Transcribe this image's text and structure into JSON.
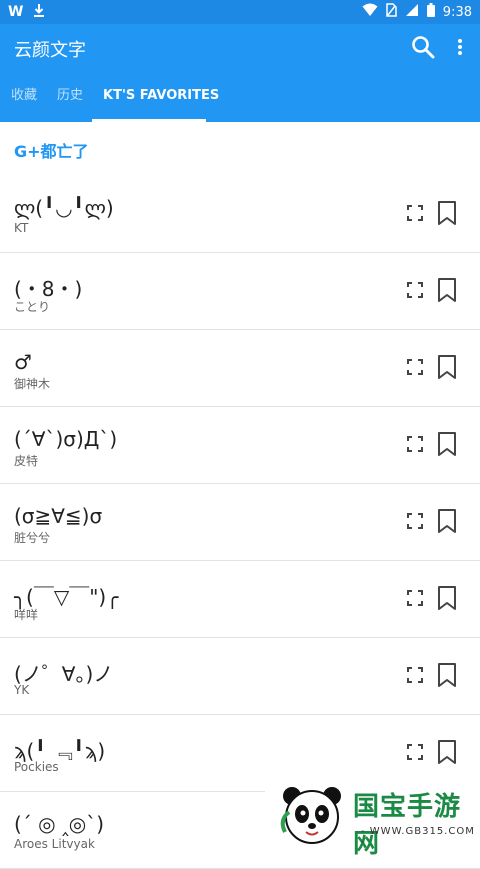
{
  "status_bar": {
    "time": "9:38",
    "left_icons": [
      "w-app-icon",
      "download-icon"
    ],
    "right_icons": [
      "wifi-icon",
      "no-sim-icon",
      "signal-icon",
      "battery-icon"
    ]
  },
  "app": {
    "title": "云颜文字"
  },
  "tabs": [
    {
      "label": "收藏",
      "active": false
    },
    {
      "label": "历史",
      "active": false
    },
    {
      "label": "KT'S FAVORITES",
      "active": true
    }
  ],
  "section": {
    "title": "G+都亡了"
  },
  "items": [
    {
      "kaomoji": "ლ(╹◡╹ლ)",
      "name": "KT"
    },
    {
      "kaomoji": "(・8・)",
      "name": "ことり"
    },
    {
      "kaomoji": "♂",
      "name": "御神木"
    },
    {
      "kaomoji": "(´∀`)σ)Д`)",
      "name": "皮特"
    },
    {
      "kaomoji": "(σ≧∀≦)σ",
      "name": "脏兮兮"
    },
    {
      "kaomoji": "╮(￣▽￣\")╭",
      "name": "咩咩"
    },
    {
      "kaomoji": "(ノ゜∀。)ノ",
      "name": "YK"
    },
    {
      "kaomoji": "ϡ(╹ ﹃╹ϡ)",
      "name": "Pockies"
    },
    {
      "kaomoji": "(´ ◎ ‸◎`)",
      "name": "Aroes Litvyak"
    }
  ],
  "watermark": {
    "text": "国宝手游网",
    "url": "- WWW.GB315.COM -"
  },
  "colors": {
    "primary": "#2196f3",
    "status": "#1e88e5",
    "accent_text": "#2196f3"
  }
}
